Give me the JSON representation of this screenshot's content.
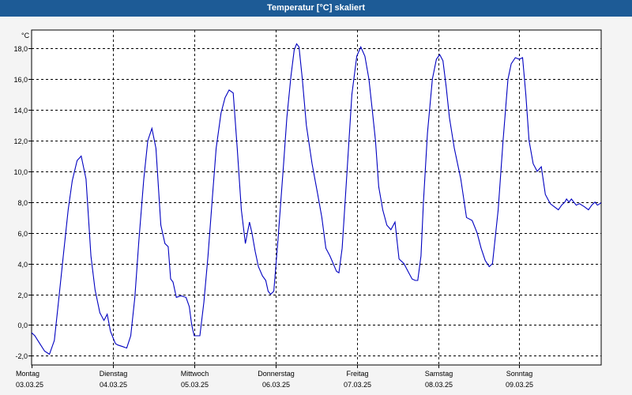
{
  "window": {
    "title": "Temperatur [°C] skaliert"
  },
  "chart_data": {
    "type": "line",
    "title": "Temperatur [°C] skaliert",
    "ylabel": "°C",
    "xlabel": "",
    "ylim": [
      -2.6,
      19.2
    ],
    "xlim": [
      0,
      7
    ],
    "grid": true,
    "yticks": [
      -2.0,
      0.0,
      2.0,
      4.0,
      6.0,
      8.0,
      10.0,
      12.0,
      14.0,
      16.0,
      18.0
    ],
    "ytick_labels": [
      "-2,0",
      "0,0",
      "2,0",
      "4,0",
      "6,0",
      "8,0",
      "10,0",
      "12,0",
      "14,0",
      "16,0",
      "18,0"
    ],
    "day_labels": [
      {
        "day": "Montag",
        "date": "03.03.25"
      },
      {
        "day": "Dienstag",
        "date": "04.03.25"
      },
      {
        "day": "Mittwoch",
        "date": "05.03.25"
      },
      {
        "day": "Donnerstag",
        "date": "06.03.25"
      },
      {
        "day": "Freitag",
        "date": "07.03.25"
      },
      {
        "day": "Samstag",
        "date": "08.03.25"
      },
      {
        "day": "Sonntag",
        "date": "09.03.25"
      }
    ],
    "series": [
      {
        "color": "#0000c0",
        "x": [
          0,
          0.04,
          0.1,
          0.16,
          0.22,
          0.28,
          0.33,
          0.39,
          0.45,
          0.5,
          0.56,
          0.61,
          0.67,
          0.7,
          0.73,
          0.78,
          0.84,
          0.89,
          0.93,
          0.97,
          1.0,
          1.03,
          1.06,
          1.12,
          1.17,
          1.22,
          1.27,
          1.32,
          1.38,
          1.43,
          1.48,
          1.53,
          1.59,
          1.64,
          1.68,
          1.71,
          1.74,
          1.78,
          1.84,
          1.9,
          1.94,
          1.97,
          2.0,
          2.03,
          2.07,
          2.12,
          2.17,
          2.22,
          2.27,
          2.33,
          2.38,
          2.43,
          2.48,
          2.53,
          2.58,
          2.63,
          2.68,
          2.71,
          2.75,
          2.79,
          2.84,
          2.88,
          2.91,
          2.94,
          2.98,
          3.03,
          3.1,
          3.14,
          3.19,
          3.23,
          3.26,
          3.29,
          3.33,
          3.38,
          3.45,
          3.52,
          3.57,
          3.62,
          3.67,
          3.71,
          3.75,
          3.78,
          3.82,
          3.88,
          3.94,
          4.0,
          4.05,
          4.1,
          4.15,
          4.19,
          4.23,
          4.27,
          4.32,
          4.37,
          4.42,
          4.47,
          4.52,
          4.58,
          4.63,
          4.68,
          4.72,
          4.75,
          4.79,
          4.82,
          4.87,
          4.93,
          4.98,
          5.02,
          5.06,
          5.1,
          5.14,
          5.2,
          5.28,
          5.35,
          5.42,
          5.48,
          5.53,
          5.58,
          5.63,
          5.67,
          5.7,
          5.74,
          5.8,
          5.86,
          5.9,
          5.95,
          6.0,
          6.04,
          6.08,
          6.12,
          6.17,
          6.22,
          6.27,
          6.32,
          6.38,
          6.43,
          6.48,
          6.52,
          6.56,
          6.58,
          6.61,
          6.64,
          6.67,
          6.7,
          6.74,
          6.8,
          6.85,
          6.89,
          6.93,
          6.96,
          6.99,
          7.02
        ],
        "values": [
          -0.5,
          -0.7,
          -1.2,
          -1.7,
          -1.9,
          -1.0,
          1.5,
          4.5,
          7.5,
          9.4,
          10.7,
          11.0,
          9.5,
          7.0,
          4.5,
          2.3,
          0.8,
          0.3,
          0.7,
          -0.4,
          -0.8,
          -1.2,
          -1.3,
          -1.4,
          -1.5,
          -0.7,
          1.8,
          5.5,
          9.5,
          12.0,
          12.8,
          11.5,
          6.5,
          5.3,
          5.1,
          3.0,
          2.8,
          1.8,
          1.9,
          1.8,
          1.2,
          0.0,
          -0.7,
          -0.7,
          -0.7,
          1.5,
          4.5,
          8.0,
          11.5,
          13.8,
          14.8,
          15.3,
          15.1,
          11.5,
          7.5,
          5.3,
          6.7,
          6.0,
          4.8,
          3.8,
          3.2,
          2.9,
          2.2,
          2.0,
          2.2,
          5.5,
          10.5,
          13.5,
          16.2,
          17.9,
          18.3,
          18.1,
          16.0,
          13.0,
          10.5,
          8.5,
          7.0,
          5.0,
          4.5,
          4.0,
          3.5,
          3.4,
          5.0,
          10.0,
          15.0,
          17.5,
          18.1,
          17.5,
          16.0,
          14.0,
          12.0,
          9.0,
          7.5,
          6.5,
          6.2,
          6.7,
          4.3,
          4.0,
          3.5,
          3.0,
          2.9,
          2.9,
          4.5,
          8.0,
          12.5,
          16.0,
          17.3,
          17.6,
          17.2,
          15.5,
          13.5,
          11.5,
          9.5,
          7.0,
          6.8,
          6.0,
          5.0,
          4.2,
          3.8,
          4.0,
          5.5,
          7.5,
          12.0,
          16.0,
          17.0,
          17.4,
          17.3,
          17.4,
          15.0,
          12.0,
          10.5,
          10.0,
          10.3,
          8.5,
          7.9,
          7.7,
          7.5,
          7.8,
          8.0,
          8.2,
          8.0,
          8.2,
          8.0,
          7.8,
          7.9,
          7.7,
          7.5,
          7.8,
          8.0,
          7.8,
          7.9,
          8.0
        ]
      }
    ]
  }
}
